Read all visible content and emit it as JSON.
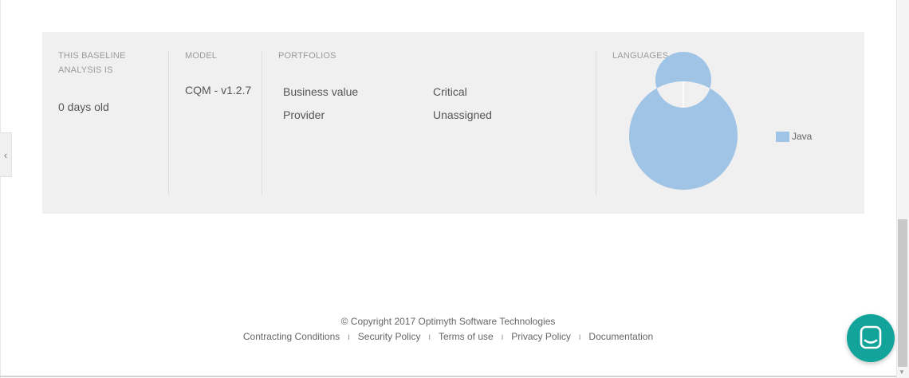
{
  "sidebar_toggle": {
    "icon": "chevron-left-icon",
    "glyph": "‹"
  },
  "summary": {
    "age": {
      "label_line1": "THIS BASELINE",
      "label_line2": "ANALYSIS IS",
      "value": "0 days old"
    },
    "model": {
      "label": "MODEL",
      "value": "CQM - v1.2.7"
    },
    "portfolios": {
      "label": "PORTFOLIOS",
      "rows": [
        {
          "name": "Business value",
          "value": "Critical"
        },
        {
          "name": "Provider",
          "value": "Unassigned"
        }
      ]
    },
    "languages": {
      "label": "LANGUAGES"
    }
  },
  "chart_data": {
    "type": "pie",
    "variant": "donut",
    "slices": [
      {
        "name": "Java",
        "value": 100,
        "color": "#a0c4e6"
      }
    ],
    "legend": "right"
  },
  "footer": {
    "copyright": "© Copyright 2017 Optimyth Software Technologies",
    "links": [
      "Contracting Conditions",
      "Security Policy",
      "Terms of use",
      "Privacy Policy",
      "Documentation"
    ],
    "separator": "I"
  },
  "chat": {
    "icon": "chat-bubble-icon",
    "color": "#12a39b"
  }
}
